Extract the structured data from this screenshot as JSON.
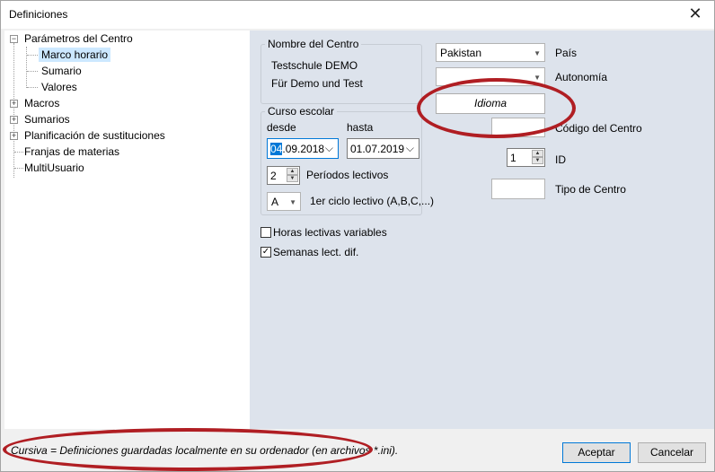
{
  "window": {
    "title": "Definiciones",
    "close_glyph": "✕"
  },
  "tree": {
    "items": [
      {
        "label": "Parámetros del Centro",
        "expander": "−"
      },
      {
        "label": "Marco horario"
      },
      {
        "label": "Sumario"
      },
      {
        "label": "Valores"
      },
      {
        "label": "Macros",
        "expander": "+"
      },
      {
        "label": "Sumarios",
        "expander": "+"
      },
      {
        "label": "Planificación de sustituciones",
        "expander": "+"
      },
      {
        "label": "Franjas de materias"
      },
      {
        "label": "MultiUsuario"
      }
    ]
  },
  "centro": {
    "group_title": "Nombre del Centro",
    "name_line1": "Testschule  DEMO",
    "name_line2": "Für Demo und Test"
  },
  "curso": {
    "group_title": "Curso escolar",
    "desde_label": "desde",
    "hasta_label": "hasta",
    "desde_selected": "04",
    "desde_rest": ".09.2018",
    "hasta_value": "01.07.2019",
    "chevron": "⌵",
    "periodos_value": "2",
    "periodos_label": "Períodos lectivos",
    "ciclo_value": "A",
    "ciclo_label": "1er ciclo lectivo (A,B,C,...)"
  },
  "right": {
    "pais_value": "Pakistan",
    "pais_label": "País",
    "autonomia_value": "",
    "autonomia_label": "Autonomía",
    "idioma_button": "Idioma",
    "codigo_label": "Código del Centro",
    "id_value": "1",
    "id_label": "ID",
    "tipo_label": "Tipo de Centro"
  },
  "options": {
    "horas_label": "Horas lectivas variables",
    "horas_checked": false,
    "semanas_label": "Semanas lect. dif.",
    "semanas_checked": true,
    "check_glyph": "✓"
  },
  "footer": {
    "note": "Cursiva = Definiciones guardadas localmente en su ordenador (en archivos *.ini).",
    "accept_label": "Aceptar",
    "cancel_label": "Cancelar"
  },
  "glyphs": {
    "dropdown": "▼",
    "spin_up": "▲",
    "spin_down": "▼"
  },
  "colors": {
    "highlight_ring": "#b01e23",
    "selection": "#cce8ff",
    "focus": "#0078d7"
  }
}
